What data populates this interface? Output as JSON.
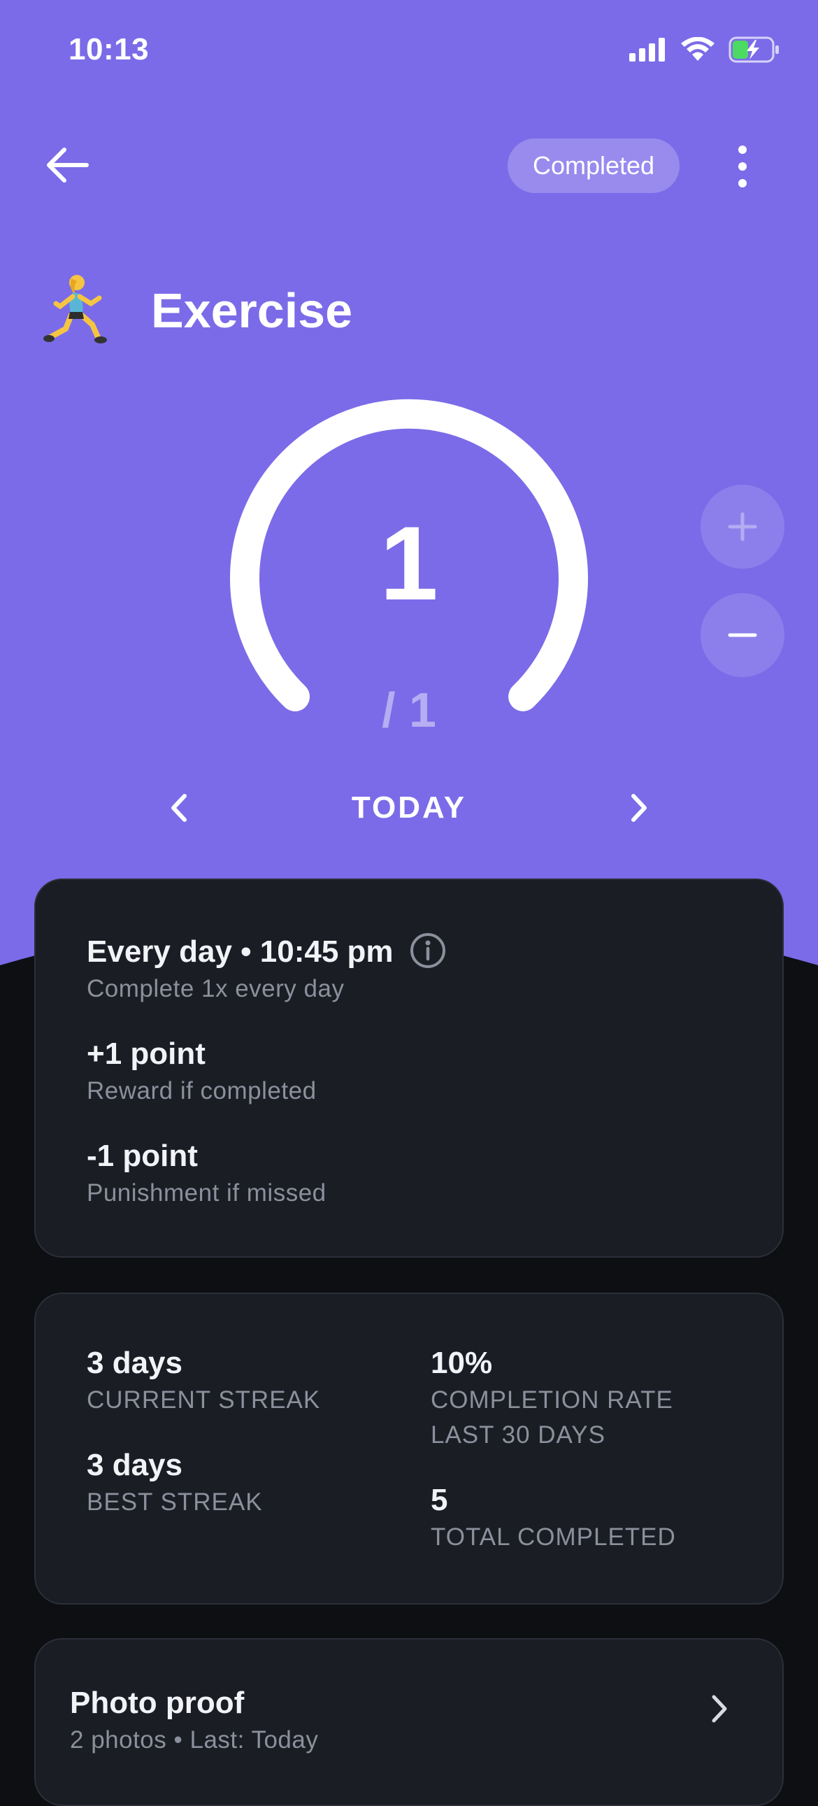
{
  "status_bar": {
    "time": "10:13",
    "icons": [
      "signal-icon",
      "wifi-icon",
      "battery-charging-icon"
    ]
  },
  "header": {
    "badge": "Completed",
    "back_icon": "arrow-left-icon",
    "more_icon": "more-vertical-icon"
  },
  "habit": {
    "emoji": "🏃‍♀️",
    "title": "Exercise"
  },
  "progress": {
    "count": "1",
    "goal": "/ 1",
    "fraction": 1.0
  },
  "day_nav": {
    "label": "TODAY"
  },
  "schedule": {
    "title": "Every day • 10:45 pm",
    "subtitle": "Complete 1x every day",
    "reward_title": "+1 point",
    "reward_sub": "Reward if completed",
    "penalty_title": "-1 point",
    "penalty_sub": "Punishment if missed"
  },
  "stats": {
    "current_streak_value": "3 days",
    "current_streak_label": "CURRENT STREAK",
    "best_streak_value": "3 days",
    "best_streak_label": "BEST STREAK",
    "completion_rate_value": "10%",
    "completion_rate_label_1": "COMPLETION RATE",
    "completion_rate_label_2": "LAST 30 DAYS",
    "total_value": "5",
    "total_label": "TOTAL COMPLETED"
  },
  "photo_proof": {
    "title": "Photo proof",
    "subtitle": "2 photos • Last: Today"
  },
  "colors": {
    "hero": "#7b6be8",
    "card": "#1a1d24",
    "background": "#0d0f13",
    "battery": "#4cd964"
  }
}
